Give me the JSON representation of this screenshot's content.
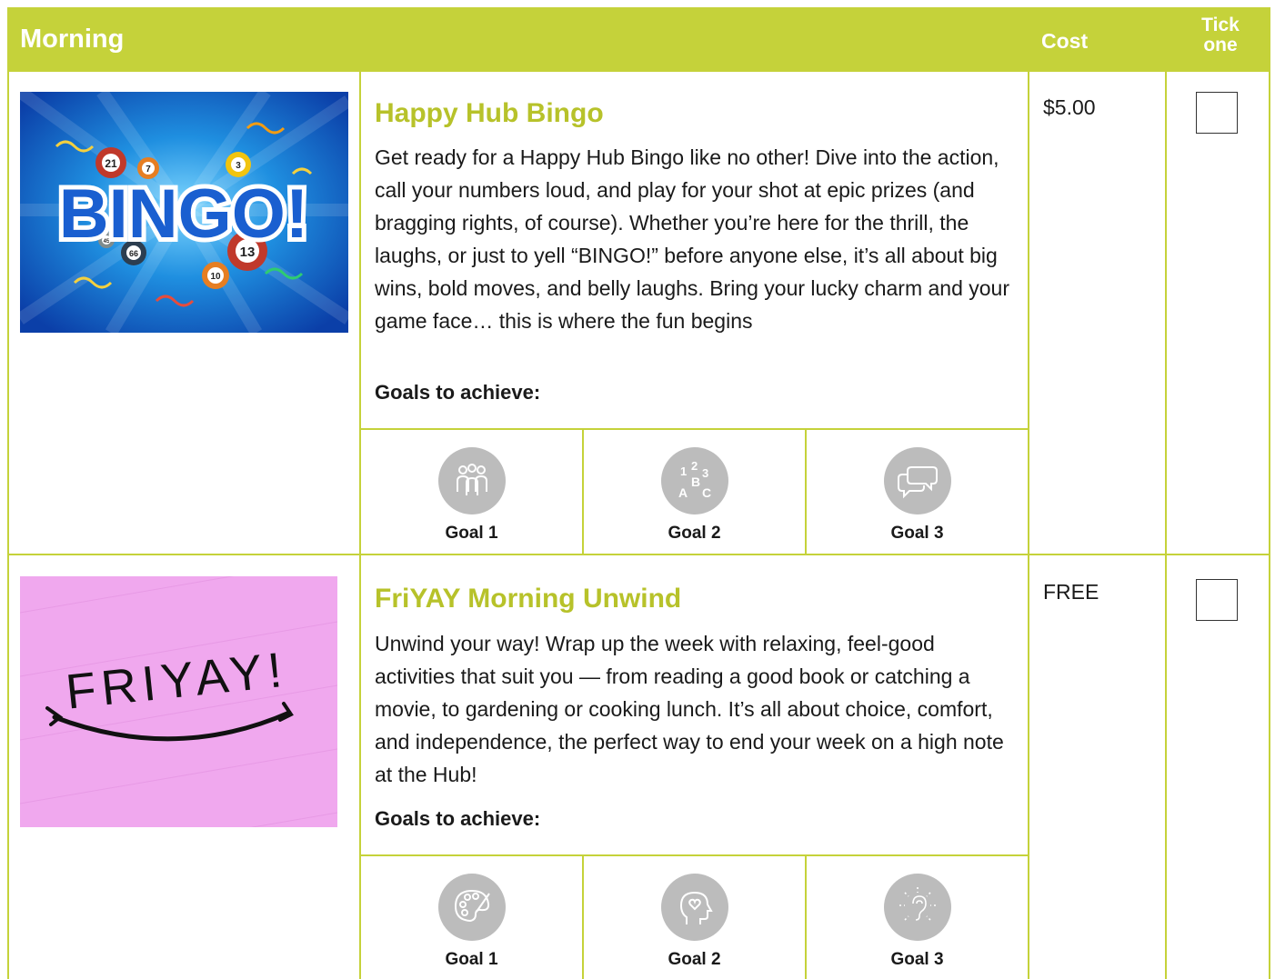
{
  "header": {
    "title": "Morning",
    "cost_label": "Cost",
    "tick_label_1": "Tick",
    "tick_label_2": "one"
  },
  "activities": [
    {
      "image_text": "BINGO!",
      "ball_numbers": [
        "21",
        "7",
        "3",
        "13",
        "10",
        "66",
        "45"
      ],
      "title": "Happy Hub Bingo",
      "description": "Get ready for a Happy Hub Bingo like no other! Dive into the action, call your numbers loud, and play for your shot at epic prizes (and bragging rights, of course). Whether you’re here for the thrill, the laughs, or just to yell “BINGO!” before anyone else, it’s all about big wins, bold moves, and belly laughs. Bring your lucky charm and your game face… this is where the fun begins",
      "goals_label": "Goals to achieve:",
      "goals": [
        {
          "label": "Goal 1",
          "icon": "people-group-icon"
        },
        {
          "label": "Goal 2",
          "icon": "numbers-letters-icon",
          "icon_text": [
            "1",
            "2",
            "3",
            "B",
            "A",
            "C"
          ]
        },
        {
          "label": "Goal 3",
          "icon": "speech-bubbles-icon"
        }
      ],
      "cost": "$5.00",
      "ticked": false
    },
    {
      "image_text": "FRIYAY!",
      "title": "FriYAY Morning Unwind",
      "description": "Unwind your way! Wrap up the week with relaxing, feel-good activities that suit you — from reading a good book or catching a movie, to gardening or cooking lunch. It’s all about choice, comfort, and independence, the perfect way to end your week on a high note at the Hub!",
      "goals_label": "Goals to achieve:",
      "goals": [
        {
          "label": "Goal 1",
          "icon": "paint-palette-icon"
        },
        {
          "label": "Goal 2",
          "icon": "head-heart-icon"
        },
        {
          "label": "Goal 3",
          "icon": "ear-listening-icon"
        }
      ],
      "cost": "FREE",
      "ticked": false
    }
  ],
  "colors": {
    "accent": "#c5d23a",
    "title": "#b7c22a",
    "icon_grey": "#bcbcbc",
    "friyay_bg": "#f0a8ee"
  }
}
